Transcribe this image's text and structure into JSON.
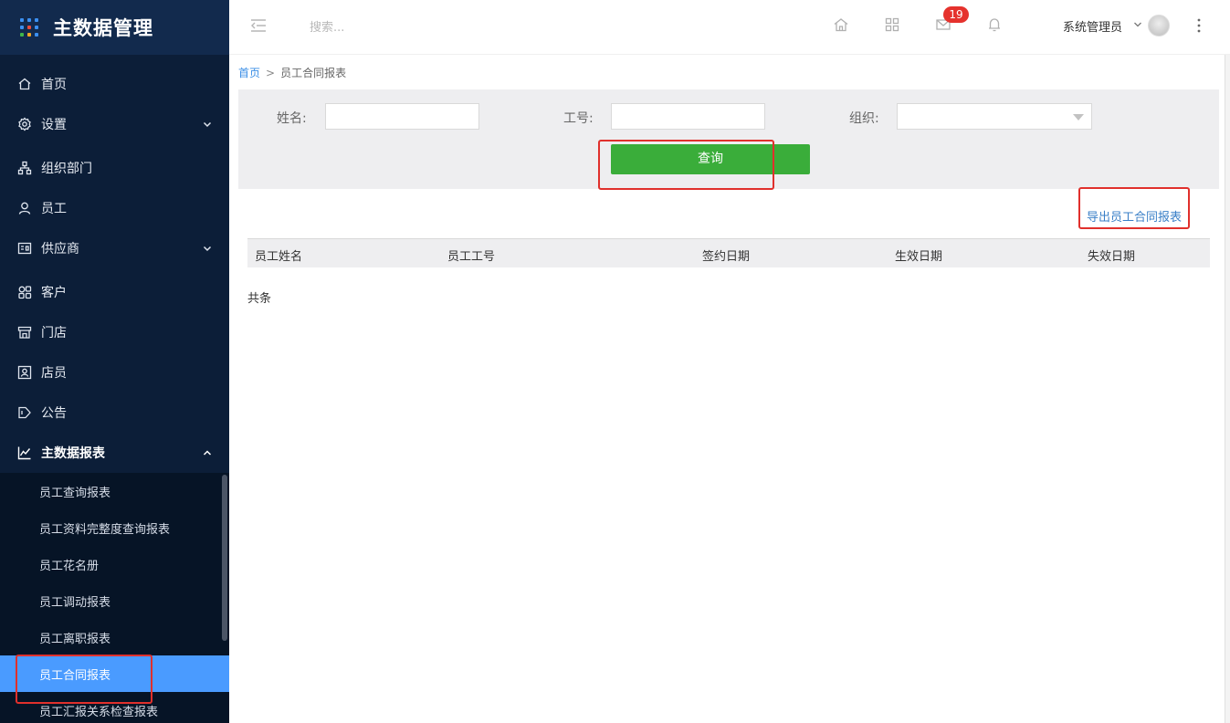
{
  "app": {
    "title": "主数据管理",
    "colors": {
      "sidebar_bg": "#0c1e38",
      "active_item": "#4a9bff",
      "primary_button": "#3aad3a",
      "badge": "#e5322d",
      "link": "#3a7fc7"
    }
  },
  "sidebar": {
    "items": [
      {
        "label": "首页",
        "icon": "home-icon"
      },
      {
        "label": "设置",
        "icon": "gear-icon",
        "expandable": true
      },
      {
        "label": "组织部门",
        "icon": "org-chart-icon"
      },
      {
        "label": "员工",
        "icon": "user-icon"
      },
      {
        "label": "供应商",
        "icon": "supplier-icon",
        "expandable": true
      },
      {
        "label": "客户",
        "icon": "customer-icon"
      },
      {
        "label": "门店",
        "icon": "store-icon"
      },
      {
        "label": "店员",
        "icon": "clerk-icon"
      },
      {
        "label": "公告",
        "icon": "announcement-icon"
      },
      {
        "label": "主数据报表",
        "icon": "chart-icon",
        "expanded": true
      }
    ],
    "submenu": [
      {
        "label": "员工查询报表"
      },
      {
        "label": "员工资料完整度查询报表"
      },
      {
        "label": "员工花名册"
      },
      {
        "label": "员工调动报表"
      },
      {
        "label": "员工离职报表"
      },
      {
        "label": "员工合同报表",
        "active": true
      },
      {
        "label": "员工汇报关系检查报表"
      }
    ]
  },
  "topbar": {
    "search_placeholder": "搜索...",
    "message_count": "19",
    "user_name": "系统管理员"
  },
  "breadcrumb": {
    "home": "首页",
    "separator": ">",
    "current": "员工合同报表"
  },
  "filters": {
    "name_label": "姓名:",
    "name_value": "",
    "id_label": "工号:",
    "id_value": "",
    "org_label": "组织:",
    "org_value": "",
    "query_button": "查询"
  },
  "export_link": "导出员工合同报表",
  "table": {
    "headers": [
      "员工姓名",
      "员工工号",
      "签约日期",
      "生效日期",
      "失效日期"
    ],
    "rows": []
  },
  "total_text": "共条"
}
